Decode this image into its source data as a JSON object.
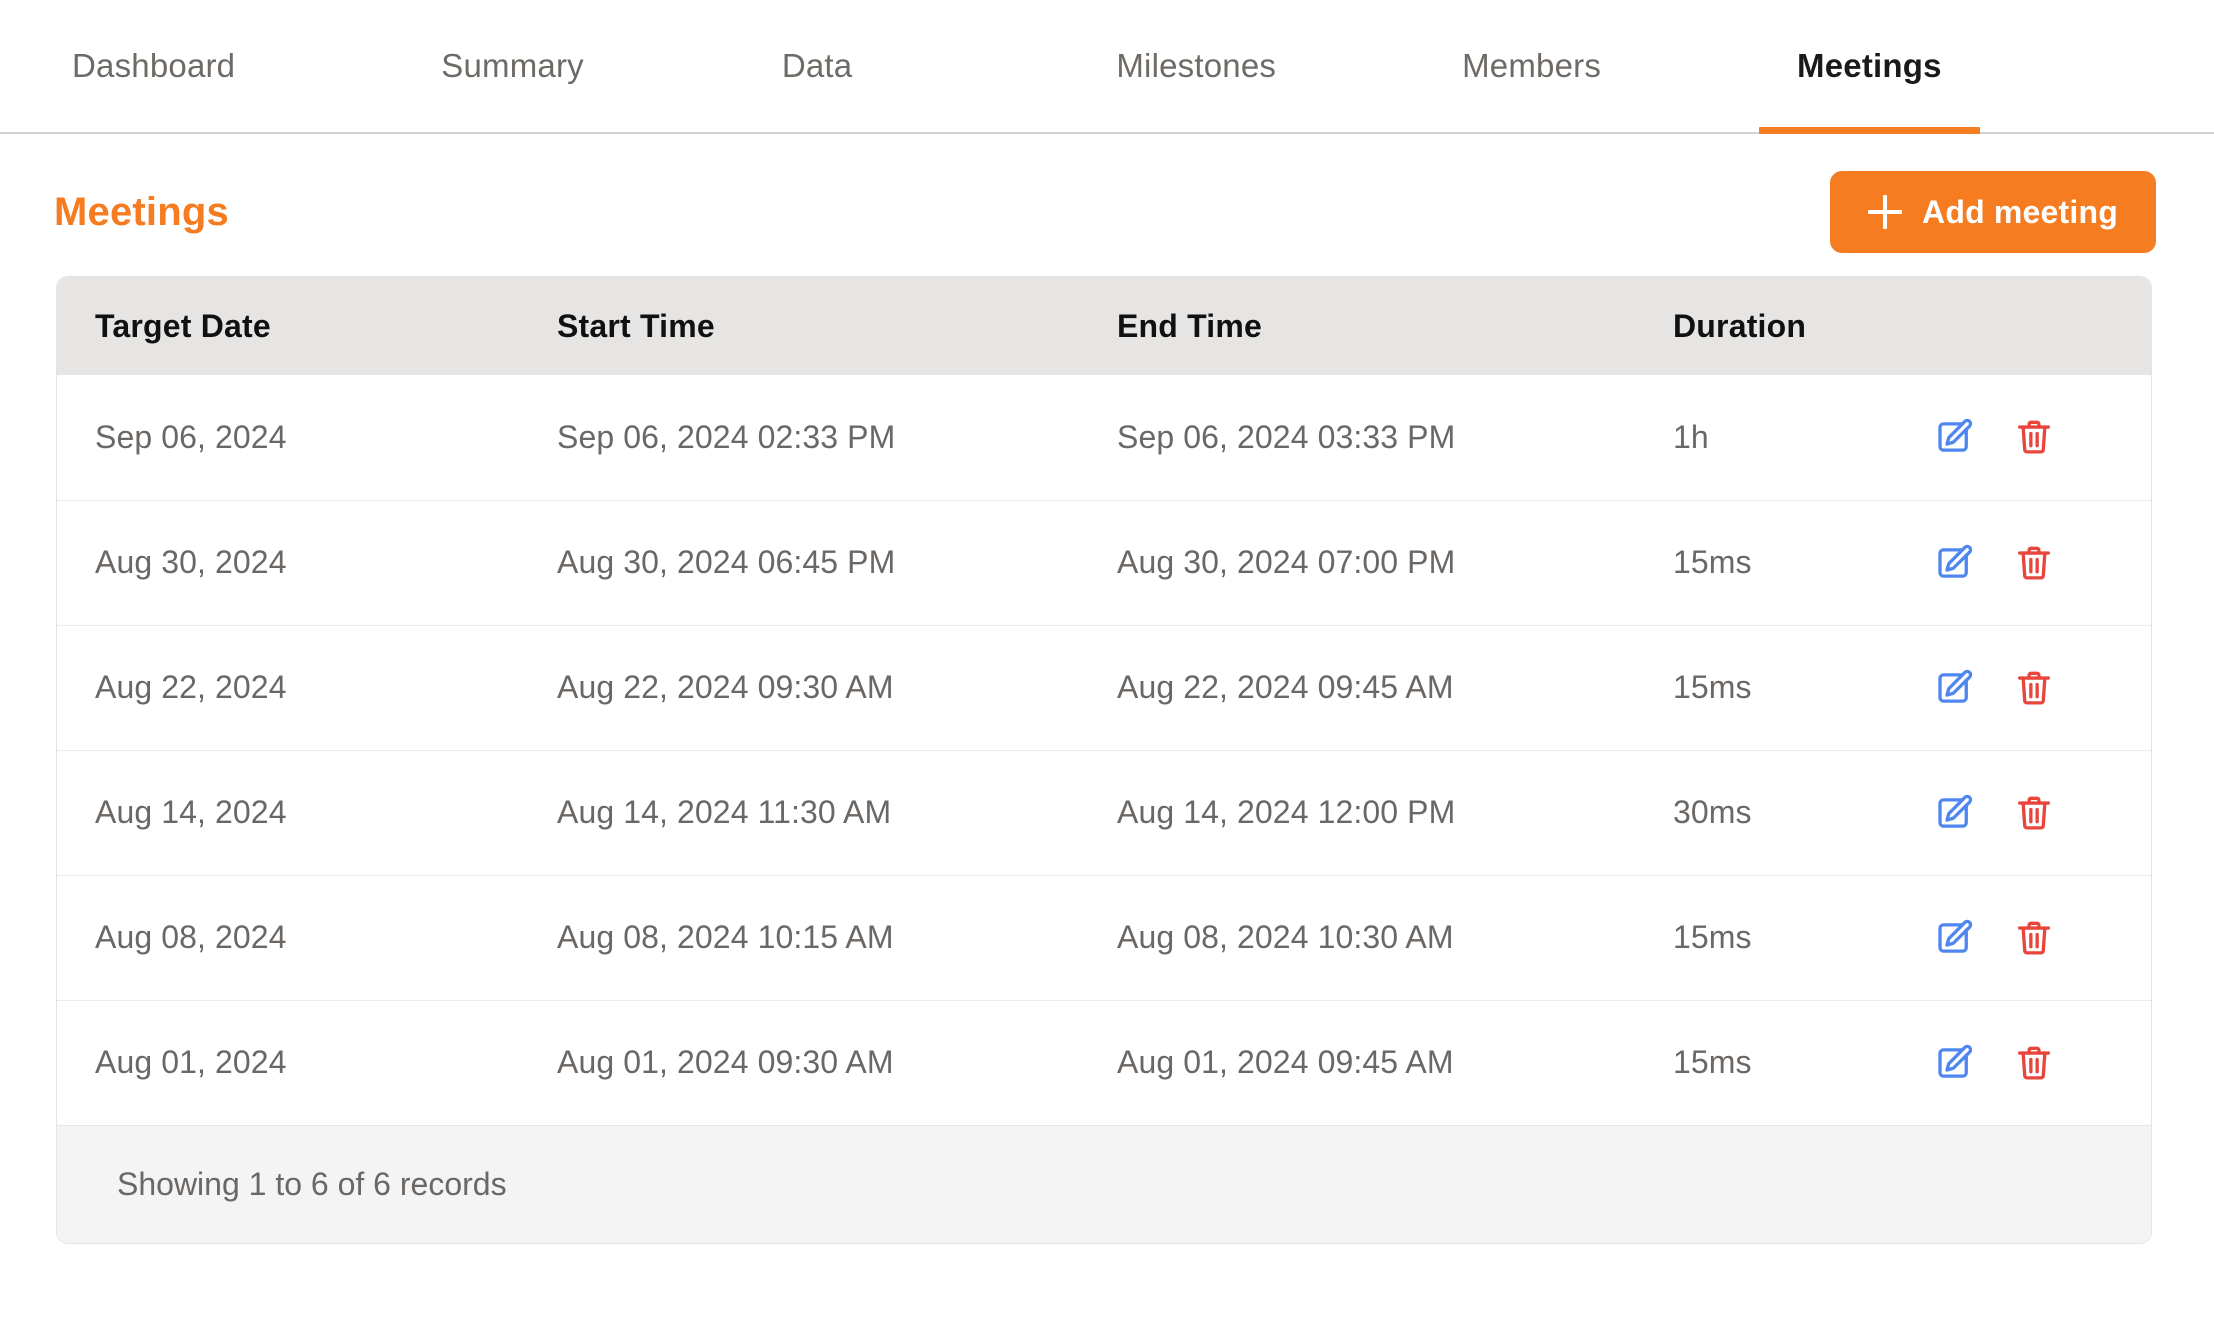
{
  "nav": {
    "tabs": [
      {
        "label": "Dashboard",
        "active": false
      },
      {
        "label": "Summary",
        "active": false
      },
      {
        "label": "Data",
        "active": false
      },
      {
        "label": "Milestones",
        "active": false
      },
      {
        "label": "Members",
        "active": false
      },
      {
        "label": "Meetings",
        "active": true
      }
    ]
  },
  "header": {
    "title": "Meetings",
    "add_button_label": "Add meeting",
    "add_button_icon": "plus-icon"
  },
  "table": {
    "columns": [
      "Target Date",
      "Start Time",
      "End Time",
      "Duration"
    ],
    "rows": [
      {
        "target_date": "Sep 06, 2024",
        "start_time": "Sep 06, 2024 02:33 PM",
        "end_time": "Sep 06, 2024 03:33 PM",
        "duration": "1h"
      },
      {
        "target_date": "Aug 30, 2024",
        "start_time": "Aug 30, 2024 06:45 PM",
        "end_time": "Aug 30, 2024 07:00 PM",
        "duration": "15ms"
      },
      {
        "target_date": "Aug 22, 2024",
        "start_time": "Aug 22, 2024 09:30 AM",
        "end_time": "Aug 22, 2024 09:45 AM",
        "duration": "15ms"
      },
      {
        "target_date": "Aug 14, 2024",
        "start_time": "Aug 14, 2024 11:30 AM",
        "end_time": "Aug 14, 2024 12:00 PM",
        "duration": "30ms"
      },
      {
        "target_date": "Aug 08, 2024",
        "start_time": "Aug 08, 2024 10:15 AM",
        "end_time": "Aug 08, 2024 10:30 AM",
        "duration": "15ms"
      },
      {
        "target_date": "Aug 01, 2024",
        "start_time": "Aug 01, 2024 09:30 AM",
        "end_time": "Aug 01, 2024 09:45 AM",
        "duration": "15ms"
      }
    ],
    "row_actions": {
      "edit_icon": "edit-pencil-icon",
      "delete_icon": "trash-icon"
    },
    "footer_text": "Showing 1 to 6 of 6 records"
  },
  "colors": {
    "accent_orange": "#f57c20",
    "edit_blue": "#4f86f0",
    "delete_red": "#e8453c",
    "header_gray": "#e6e5e4",
    "footer_gray": "#f4f4f4",
    "body_text": "#6b6764"
  }
}
